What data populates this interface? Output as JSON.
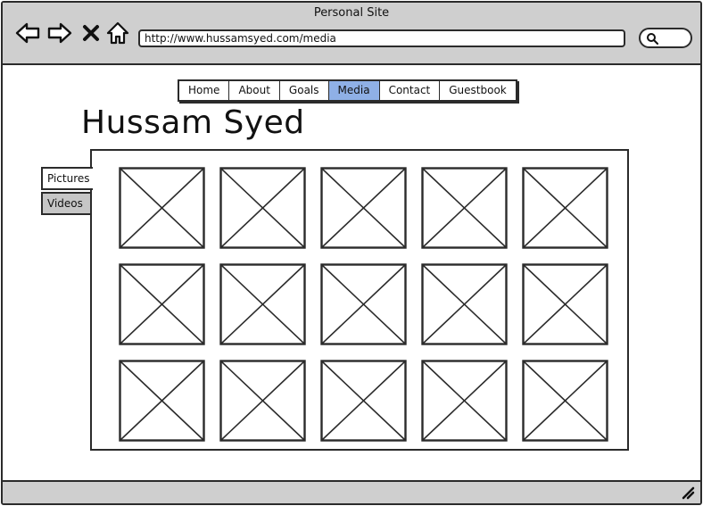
{
  "window": {
    "title": "Personal Site"
  },
  "browser": {
    "back_icon": "arrow-left-icon",
    "forward_icon": "arrow-right-icon",
    "stop_icon": "close-icon",
    "home_icon": "home-icon",
    "url": "http://www.hussamsyed.com/media",
    "search_icon": "search-icon"
  },
  "nav": {
    "items": [
      {
        "label": "Home",
        "active": false
      },
      {
        "label": "About",
        "active": false
      },
      {
        "label": "Goals",
        "active": false
      },
      {
        "label": "Media",
        "active": true
      },
      {
        "label": "Contact",
        "active": false
      },
      {
        "label": "Guestbook",
        "active": false
      }
    ],
    "active_color": "#8fb0e6"
  },
  "page": {
    "title": "Hussam Syed"
  },
  "tabs": [
    {
      "label": "Pictures",
      "selected": true
    },
    {
      "label": "Videos",
      "selected": false
    }
  ],
  "gallery": {
    "rows": 3,
    "columns": 5,
    "item_icon": "image-placeholder-icon"
  },
  "status_bar": {
    "resize_icon": "resize-grip-icon"
  },
  "colors": {
    "chrome": "#cfcfcf",
    "border": "#2b2b2b",
    "tab_inactive": "#c6c6c6"
  }
}
